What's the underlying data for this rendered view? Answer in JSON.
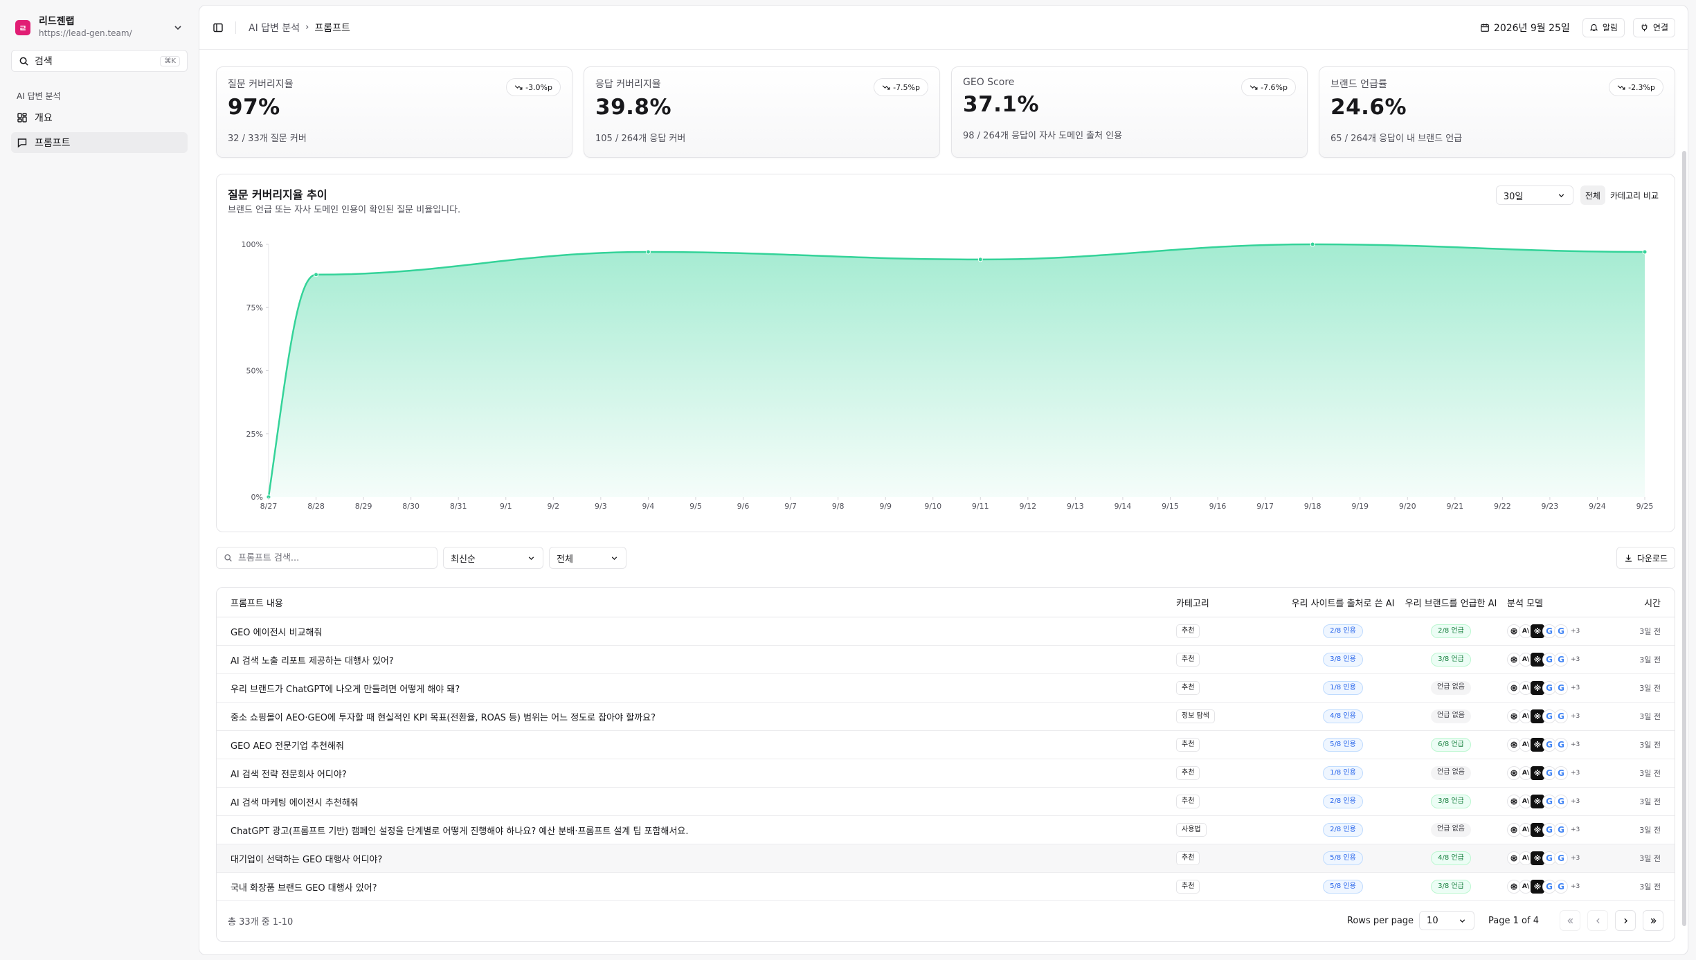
{
  "sidebar": {
    "team_logo": "ㄹ",
    "team_name": "리드젠랩",
    "team_url": "https://lead-gen.team/",
    "search_label": "검색",
    "search_shortcut": "⌘K",
    "group_label": "AI 답변 분석",
    "items": [
      {
        "label": "개요",
        "icon": "layout-dashboard-icon"
      },
      {
        "label": "프롬프트",
        "icon": "message-square-icon"
      }
    ]
  },
  "header": {
    "breadcrumb": [
      "AI 답변 분석",
      "프롬프트"
    ],
    "date": "2026년 9월 25일",
    "alerts_label": "알림",
    "connect_label": "연결"
  },
  "kpis": [
    {
      "title": "질문 커버리지율",
      "value": "97%",
      "delta": "-3.0%p",
      "sub": "32 / 33개 질문 커버"
    },
    {
      "title": "응답 커버리지율",
      "value": "39.8%",
      "delta": "-7.5%p",
      "sub": "105 / 264개 응답 커버"
    },
    {
      "title": "GEO Score",
      "value": "37.1%",
      "delta": "-7.6%p",
      "sub": "98 / 264개 응답이 자사 도메인 출처 인용"
    },
    {
      "title": "브랜드 언급률",
      "value": "24.6%",
      "delta": "-2.3%p",
      "sub": "65 / 264개 응답이 내 브랜드 언급"
    }
  ],
  "chart_card": {
    "title": "질문 커버리지율 추이",
    "description": "브랜드 언급 또는 자사 도메인 인용이 확인된 질문 비율입니다.",
    "range_value": "30일",
    "segments": [
      "전체",
      "카테고리 비교"
    ],
    "active_segment": "전체"
  },
  "chart_data": {
    "type": "area",
    "x": [
      "8/27",
      "8/28",
      "8/29",
      "8/30",
      "8/31",
      "9/1",
      "9/2",
      "9/3",
      "9/4",
      "9/5",
      "9/6",
      "9/7",
      "9/8",
      "9/9",
      "9/10",
      "9/11",
      "9/12",
      "9/13",
      "9/14",
      "9/15",
      "9/16",
      "9/17",
      "9/18",
      "9/19",
      "9/20",
      "9/21",
      "9/22",
      "9/23",
      "9/24",
      "9/25"
    ],
    "points": [
      {
        "x": "8/27",
        "y": 0
      },
      {
        "x": "8/28",
        "y": 88
      },
      {
        "x": "9/4",
        "y": 97
      },
      {
        "x": "9/11",
        "y": 94
      },
      {
        "x": "9/18",
        "y": 100
      },
      {
        "x": "9/25",
        "y": 97
      }
    ],
    "y_ticks": [
      "0%",
      "25%",
      "50%",
      "75%",
      "100%"
    ],
    "ylim": [
      0,
      100
    ],
    "grid": false,
    "color": "#34d399"
  },
  "filters": {
    "search_placeholder": "프롬프트 검색...",
    "sort_value": "최신순",
    "category_value": "전체",
    "download_label": "다운로드"
  },
  "table": {
    "columns": [
      "프롬프트 내용",
      "카테고리",
      "우리 사이트를 출처로 쓴 AI",
      "우리 브랜드를 언급한 AI",
      "분석 모델",
      "시간"
    ],
    "rows": [
      {
        "prompt": "GEO 에이전시 비교해줘",
        "category": "추천",
        "cited": "2/8 인용",
        "brand": "2/8 언급",
        "brand_mentioned": true,
        "more": "+3",
        "time": "3일 전"
      },
      {
        "prompt": "AI 검색 노출 리포트 제공하는 대행사 있어?",
        "category": "추천",
        "cited": "3/8 인용",
        "brand": "3/8 언급",
        "brand_mentioned": true,
        "more": "+3",
        "time": "3일 전"
      },
      {
        "prompt": "우리 브랜드가 ChatGPT에 나오게 만들려면 어떻게 해야 돼?",
        "category": "추천",
        "cited": "1/8 인용",
        "brand": "언급 없음",
        "brand_mentioned": false,
        "more": "+3",
        "time": "3일 전"
      },
      {
        "prompt": "중소 쇼핑몰이 AEO·GEO에 투자할 때 현실적인 KPI 목표(전환율, ROAS 등) 범위는 어느 정도로 잡아야 할까요?",
        "category": "정보 탐색",
        "cited": "4/8 인용",
        "brand": "언급 없음",
        "brand_mentioned": false,
        "more": "+3",
        "time": "3일 전"
      },
      {
        "prompt": "GEO AEO 전문기업 추천해줘",
        "category": "추천",
        "cited": "5/8 인용",
        "brand": "6/8 언급",
        "brand_mentioned": true,
        "more": "+3",
        "time": "3일 전"
      },
      {
        "prompt": "AI 검색 전략 전문회사 어디야?",
        "category": "추천",
        "cited": "1/8 인용",
        "brand": "언급 없음",
        "brand_mentioned": false,
        "more": "+3",
        "time": "3일 전"
      },
      {
        "prompt": "AI 검색 마케팅 에이전시 추천해줘",
        "category": "추천",
        "cited": "2/8 인용",
        "brand": "3/8 언급",
        "brand_mentioned": true,
        "more": "+3",
        "time": "3일 전"
      },
      {
        "prompt": "ChatGPT 광고(프롬프트 기반) 캠페인 설정을 단계별로 어떻게 진행해야 하나요? 예산 분배·프롬프트 설계 팁 포함해서요.",
        "category": "사용법",
        "cited": "2/8 인용",
        "brand": "언급 없음",
        "brand_mentioned": false,
        "more": "+3",
        "time": "3일 전"
      },
      {
        "prompt": "대기업이 선택하는 GEO 대행사 어디야?",
        "category": "추천",
        "cited": "5/8 인용",
        "brand": "4/8 언급",
        "brand_mentioned": true,
        "more": "+3",
        "time": "3일 전"
      },
      {
        "prompt": "국내 화장품 브랜드 GEO 대행사 있어?",
        "category": "추천",
        "cited": "5/8 인용",
        "brand": "3/8 언급",
        "brand_mentioned": true,
        "more": "+3",
        "time": "3일 전"
      }
    ],
    "count_text": "총 33개 중 1-10",
    "rows_per_page_label": "Rows per page",
    "rows_per_page_value": "10",
    "page_info": "Page 1 of 4"
  }
}
